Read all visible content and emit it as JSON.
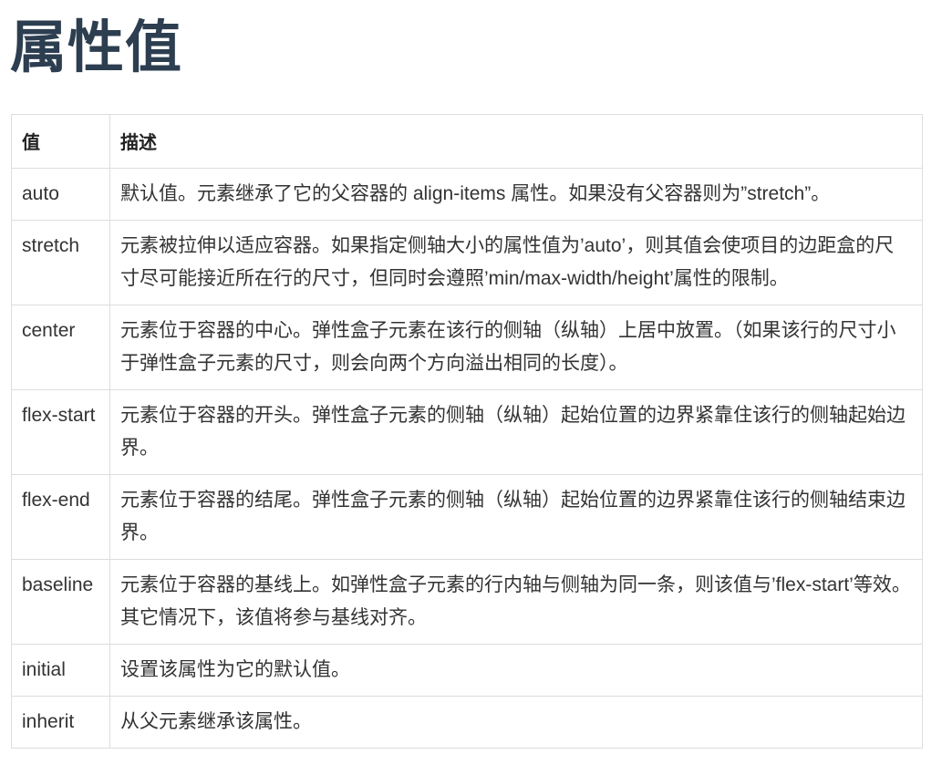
{
  "page": {
    "title": "属性值"
  },
  "table": {
    "headers": {
      "value": "值",
      "description": "描述"
    },
    "rows": [
      {
        "value": "auto",
        "description": "默认值。元素继承了它的父容器的 align-items 属性。如果没有父容器则为”stretch”。"
      },
      {
        "value": "stretch",
        "description": "元素被拉伸以适应容器。如果指定侧轴大小的属性值为’auto’，则其值会使项目的边距盒的尺寸尽可能接近所在行的尺寸，但同时会遵照’min/max-width/height’属性的限制。"
      },
      {
        "value": "center",
        "description": "元素位于容器的中心。弹性盒子元素在该行的侧轴（纵轴）上居中放置。（如果该行的尺寸小于弹性盒子元素的尺寸，则会向两个方向溢出相同的长度）。"
      },
      {
        "value": "flex-start",
        "description": "元素位于容器的开头。弹性盒子元素的侧轴（纵轴）起始位置的边界紧靠住该行的侧轴起始边界。"
      },
      {
        "value": "flex-end",
        "description": "元素位于容器的结尾。弹性盒子元素的侧轴（纵轴）起始位置的边界紧靠住该行的侧轴结束边界。"
      },
      {
        "value": "baseline",
        "description": "元素位于容器的基线上。如弹性盒子元素的行内轴与侧轴为同一条，则该值与’flex-start’等效。其它情况下，该值将参与基线对齐。"
      },
      {
        "value": "initial",
        "description": "设置该属性为它的默认值。"
      },
      {
        "value": "inherit",
        "description": "从父元素继承该属性。"
      }
    ]
  },
  "colors": {
    "title": "#2c3e50",
    "border": "#dddddd",
    "text": "#333333"
  }
}
